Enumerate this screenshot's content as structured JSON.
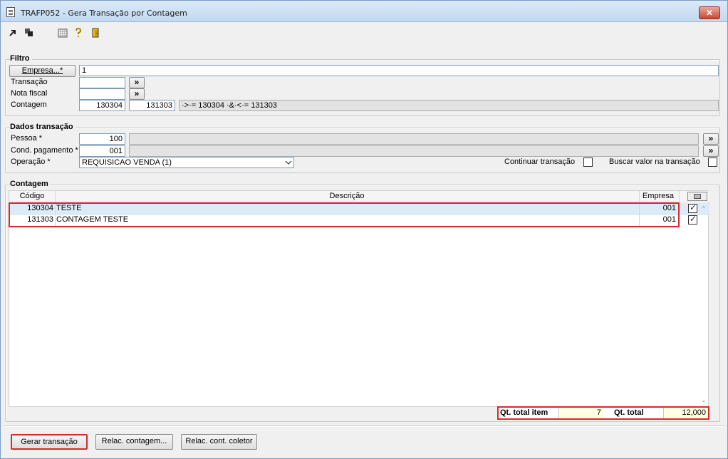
{
  "window": {
    "title": "TRAFP052 - Gera Transação por Contagem",
    "close_label": "✕"
  },
  "toolbar": {
    "icons": [
      "arrow-right-icon",
      "copy-icon",
      "calendar-icon",
      "help-icon",
      "exit-door-icon"
    ]
  },
  "filtro": {
    "title": "Filtro",
    "empresa_button": "Empresa...*",
    "empresa_value": "1",
    "transacao_label": "Transação",
    "transacao_value": "",
    "nota_fiscal_label": "Nota fiscal",
    "nota_fiscal_value": "",
    "lookup_label": "»",
    "contagem_label": "Contagem",
    "contagem_from": "130304",
    "contagem_to": "131303",
    "contagem_expression": "·>·= 130304 ·&·<·= 131303"
  },
  "dados": {
    "title": "Dados transação",
    "pessoa_label": "Pessoa *",
    "pessoa_value": "100",
    "pessoa_desc": "",
    "cond_label": "Cond. pagamento *",
    "cond_value": "001",
    "cond_desc": "",
    "operacao_label": "Operação *",
    "operacao_value": "REQUISICAO VENDA (1)",
    "continuar_label": "Continuar transação",
    "buscar_label": "Buscar valor na transação"
  },
  "contagem": {
    "title": "Contagem",
    "columns": {
      "codigo": "Código",
      "descricao": "Descrição",
      "empresa": "Empresa"
    },
    "rows": [
      {
        "codigo": "130304",
        "descricao": "TESTE",
        "empresa": "001",
        "checked": true
      },
      {
        "codigo": "131303",
        "descricao": "CONTAGEM TESTE",
        "empresa": "001",
        "checked": true
      }
    ]
  },
  "totals": {
    "qt_item_label": "Qt. total item",
    "qt_item_value": "7",
    "qt_total_label": "Qt. total",
    "qt_total_value": "12,000"
  },
  "buttons": {
    "gerar": "Gerar transação",
    "relac_contagem": "Relac. contagem...",
    "relac_coletor": "Relac. cont. coletor"
  }
}
